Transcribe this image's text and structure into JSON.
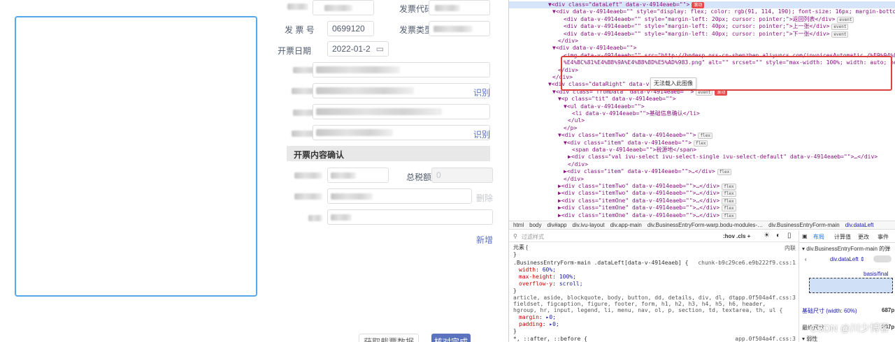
{
  "form": {
    "fields": [
      {
        "label": "发票代码",
        "value": ""
      },
      {
        "label": "发 票 号",
        "value": "0699120"
      },
      {
        "label": "发票类型",
        "value": ""
      },
      {
        "label": "开票日期",
        "value": "2022-01-2"
      },
      {
        "label": "购方名称",
        "value": ""
      },
      {
        "label": "购方识别号",
        "value": ""
      },
      {
        "label": "销方名称",
        "value": ""
      },
      {
        "label": "销方识别号",
        "value": ""
      }
    ],
    "identify_1": "识别",
    "identify_2": "识别",
    "section_title": "开票内容确认",
    "total_tax_label": "总税额",
    "total_tax_value": "0",
    "delete_link": "删除",
    "add_link": "新增",
    "btn_fetch": "获取截票数据",
    "btn_verify": "核对完成"
  },
  "devtools": {
    "dom_lines": [
      {
        "indent": 56,
        "html": "▼<div class=\"dataLeft\" data-v-4914eaeb=\"\">",
        "badge": "滚动",
        "badge_red": true,
        "selected": true
      },
      {
        "indent": 62,
        "html": "▼<div data-v-4914eaeb=\"\" style=\"display: flex; color: rgb(91, 114, 190); font-size: 16px; margin-bottom: 10px;\">",
        "badge": "flex"
      },
      {
        "indent": 78,
        "html": "<div data-v-4914eaeb=\"\" style=\"margin-left: 20px; cursor: pointer;\">返回列表</div>",
        "badge": "event"
      },
      {
        "indent": 78,
        "html": "<div data-v-4914eaeb=\"\" style=\"margin-left: 40px; cursor: pointer;\">上一张</div>",
        "badge": "event"
      },
      {
        "indent": 78,
        "html": "<div data-v-4914eaeb=\"\" style=\"margin-left: 40px; cursor: pointer;\">下一张</div>",
        "badge": "event"
      },
      {
        "indent": 70,
        "html": "</div>"
      },
      {
        "indent": 62,
        "html": "▼<div data-v-4914eaeb=\"\">"
      },
      {
        "indent": 78,
        "html": "<img data-v-4914eaeb=\"\" src=\"http://bndesp.oss-cn-shenzhen.aliyuncs.com/invoicesAutomatic…/%E9%94%80%E6%96%B9"
      },
      {
        "indent": 78,
        "html": "%E4%BC%81%E4%B8%9A%E4%B8%8D%E5%AD%983.png\" alt=\"\" srcset=\"\" style=\"max-width: 100%; width: auto; height: auto;\">"
      },
      {
        "indent": 70,
        "html": "</div>"
      },
      {
        "indent": 62,
        "html": "</div>"
      },
      {
        "indent": 56,
        "html": "▼<div class=\"dataRight\" data-v-4914eaeb=\"\">"
      },
      {
        "indent": 62,
        "html": "▼<div class=\"fromData\" data-v-4914eaeb=\"\">",
        "badge": "event",
        "badge2": "滚动"
      },
      {
        "indent": 70,
        "html": "▼<p class=\"tit\" data-v-4914eaeb=\"\">"
      },
      {
        "indent": 78,
        "html": "▼<ul data-v-4914eaeb=\"\">"
      },
      {
        "indent": 90,
        "html": "<li data-v-4914eaeb=\"\">基础信息确认</li>"
      },
      {
        "indent": 84,
        "html": "</ul>"
      },
      {
        "indent": 78,
        "html": "</p>"
      },
      {
        "indent": 70,
        "html": "▼<div class=\"itemTwo\" data-v-4914eaeb=\"\">",
        "badge": "flex"
      },
      {
        "indent": 78,
        "html": "▼<div class=\"item\" data-v-4914eaeb=\"\">",
        "badge": "flex"
      },
      {
        "indent": 90,
        "html": "<span data-v-4914eaeb=\"\">税源地</span>"
      },
      {
        "indent": 84,
        "html": "▶<div class=\"val ivu-select ivu-select-single ivu-select-default\" data-v-4914eaeb=\"\">…</div>"
      },
      {
        "indent": 84,
        "html": "</div>"
      },
      {
        "indent": 78,
        "html": "▶<div class=\"item\" data-v-4914eaeb=\"\">…</div>",
        "badge": "flex"
      },
      {
        "indent": 78,
        "html": "</div>"
      },
      {
        "indent": 70,
        "html": "▶<div class=\"itemTwo\" data-v-4914eaeb=\"\">…</div>",
        "badge": "flex"
      },
      {
        "indent": 70,
        "html": "▶<div class=\"itemTwo\" data-v-4914eaeb=\"\">…</div>",
        "badge": "flex"
      },
      {
        "indent": 70,
        "html": "▶<div class=\"itemOne\" data-v-4914eaeb=\"\">…</div>",
        "badge": "flex"
      },
      {
        "indent": 70,
        "html": "▶<div class=\"itemOne\" data-v-4914eaeb=\"\">…</div>",
        "badge": "flex"
      },
      {
        "indent": 70,
        "html": "▶<div class=\"itemOne\" data-v-4914eaeb=\"\">…</div>",
        "badge": "flex"
      }
    ],
    "tooltip": "无法载入此图像",
    "breadcrumbs": [
      "html",
      "body",
      "div#app",
      "div.ivu-layout",
      "div.app-main",
      "div.BusinessEntryForm-warp.bodu-modules-…",
      "div.BusinessEntryForm-main",
      "div.dataLeft"
    ],
    "filter_placeholder": "过滤样式",
    "filter_tools": ":hov .cls +",
    "element_label": "元素 {",
    "inline_label": "内联",
    "rule1_selector": ".BusinessEntryForm-main .dataLeft[data-v-4914eaeb] {",
    "rule1_source": "chunk-b9c29ce6.e9b222f9.css:1",
    "rule1_props": [
      {
        "prop": "width",
        "val": "60%;"
      },
      {
        "prop": "max-height",
        "val": "100%;"
      },
      {
        "prop": "overflow-y",
        "val": "scroll;"
      }
    ],
    "rule2_selector": "article, aside, blockquote, body, button, dd, details, div, dl, dt,",
    "rule2_selector2": "fieldset, figcaption, figure, footer, form, h1, h2, h3, h4, h5, h6, header,",
    "rule2_selector3": "hgroup, hr, input, legend, li, menu, nav, ol, p, section, td, textarea, th, ul {",
    "rule2_source": "app.0f504a4f.css:3",
    "rule2_props": [
      {
        "prop": "margin",
        "val": "▸0;"
      },
      {
        "prop": "padding",
        "val": "▸0;"
      }
    ],
    "rule3_selector": "*, ::after, ::before {",
    "rule3_source": "app.0f504a4f.css:3",
    "layout_tabs": [
      "布局",
      "计算值",
      "更改",
      "事件"
    ],
    "layout_title": "div.BusinessEntryForm-main 的弹",
    "layout_element": "div.dataLeft",
    "layout_basis": "basis/final",
    "layout_size_label": "基础尺寸",
    "layout_size_value": "(width: 60%)",
    "layout_size_px": "687p",
    "layout_final_label": "最终尺寸",
    "layout_final_px": "687p",
    "layout_tail": "弱性"
  },
  "watermark": "CSDN @川少博客"
}
